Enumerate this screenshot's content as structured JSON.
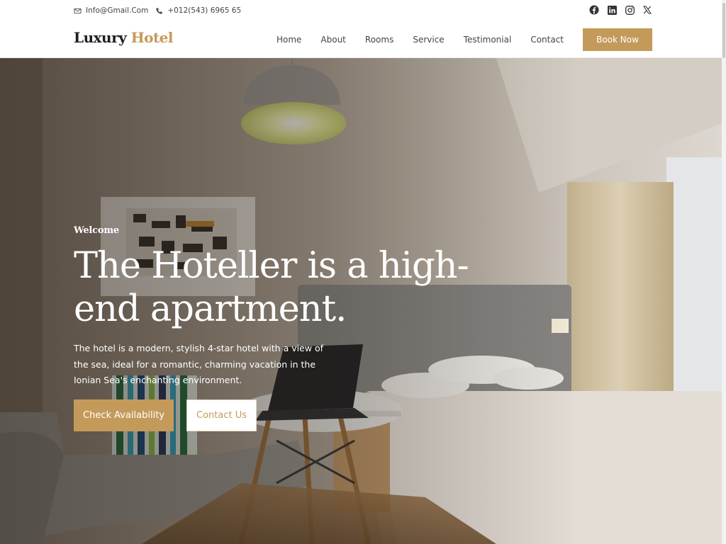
{
  "topbar": {
    "email": "Info@Gmail.Com",
    "phone": "+012(543) 6965 65",
    "social": [
      {
        "icon": "facebook-icon"
      },
      {
        "icon": "linkedin-icon"
      },
      {
        "icon": "instagram-icon"
      },
      {
        "icon": "x-twitter-icon"
      }
    ]
  },
  "brand": {
    "name": "Luxury",
    "accent": "Hotel"
  },
  "nav": {
    "items": [
      "Home",
      "About",
      "Rooms",
      "Service",
      "Testimonial",
      "Contact"
    ],
    "cta": "Book Now"
  },
  "hero": {
    "eyebrow": "Welcome",
    "headline": "The Hoteller is a high-end apartment.",
    "description": "The hotel is a modern, stylish 4-star hotel with a view of the sea, ideal for a romantic, charming vacation in the Ionian Sea's enchanting environment.",
    "primary_cta": "Check Availability",
    "secondary_cta": "Contact Us"
  },
  "colors": {
    "accent": "#c49a5a",
    "dark": "#1e1e1e"
  }
}
